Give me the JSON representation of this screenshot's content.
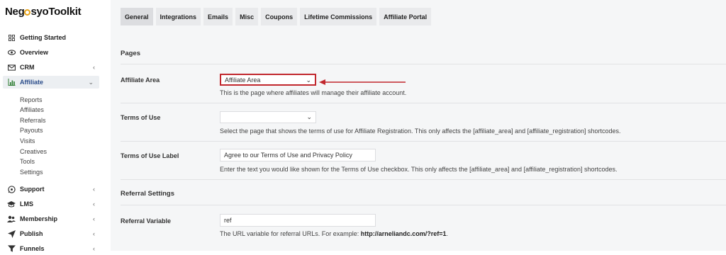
{
  "brand": {
    "name_prefix": "Neg",
    "name_suffix": "syoToolkit",
    "accent": "#e8a317"
  },
  "sidebar": {
    "items": [
      {
        "label": "Getting Started",
        "icon": "grid-icon"
      },
      {
        "label": "Overview",
        "icon": "eye-icon"
      },
      {
        "label": "CRM",
        "icon": "mail-icon"
      },
      {
        "label": "Affiliate",
        "icon": "bar-chart-icon"
      },
      {
        "label": "Support",
        "icon": "whatsapp-icon"
      },
      {
        "label": "LMS",
        "icon": "graduation-cap-icon"
      },
      {
        "label": "Membership",
        "icon": "users-icon"
      },
      {
        "label": "Publish",
        "icon": "send-icon"
      },
      {
        "label": "Funnels",
        "icon": "funnel-icon"
      }
    ],
    "affiliate_sub": [
      "Reports",
      "Affiliates",
      "Referrals",
      "Payouts",
      "Visits",
      "Creatives",
      "Tools",
      "Settings"
    ]
  },
  "tabs": [
    "General",
    "Integrations",
    "Emails",
    "Misc",
    "Coupons",
    "Lifetime Commissions",
    "Affiliate Portal"
  ],
  "pages_section": "Pages",
  "affiliate_area": {
    "label": "Affiliate Area",
    "value": "Affiliate Area",
    "desc": "This is the page where affiliates will manage their affiliate account."
  },
  "terms_of_use": {
    "label": "Terms of Use",
    "value": "",
    "desc": "Select the page that shows the terms of use for Affiliate Registration. This only affects the [affiliate_area] and [affiliate_registration] shortcodes."
  },
  "terms_label": {
    "label": "Terms of Use Label",
    "value": "Agree to our Terms of Use and Privacy Policy",
    "desc": "Enter the text you would like shown for the Terms of Use checkbox. This only affects the [affiliate_area] and [affiliate_registration] shortcodes."
  },
  "referral_section": "Referral Settings",
  "referral_variable": {
    "label": "Referral Variable",
    "value": "ref",
    "desc_prefix": "The URL variable for referral URLs. For example: ",
    "desc_example": "http://arneliandc.com/?ref=1",
    "desc_suffix": "."
  },
  "colors": {
    "highlight": "#c1272d",
    "active_text": "#2a4c8a"
  }
}
